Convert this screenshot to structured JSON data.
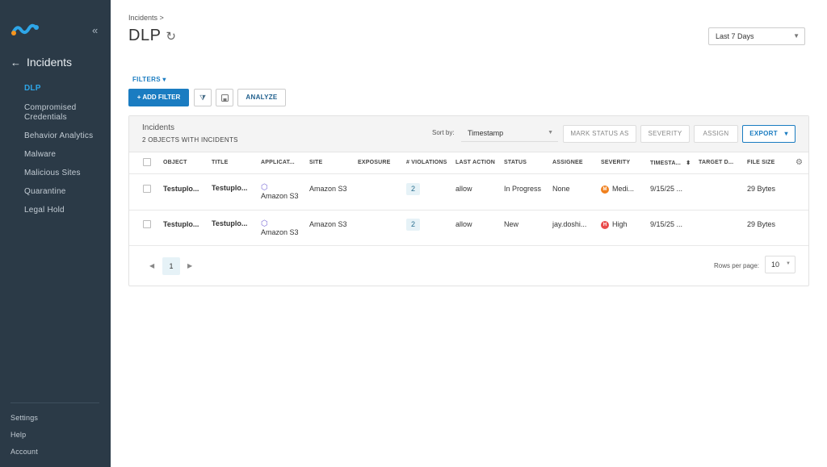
{
  "sidebar": {
    "back_label": "Incidents",
    "items": [
      {
        "label": "DLP"
      },
      {
        "label": "Compromised Credentials"
      },
      {
        "label": "Behavior Analytics"
      },
      {
        "label": "Malware"
      },
      {
        "label": "Malicious Sites"
      },
      {
        "label": "Quarantine"
      },
      {
        "label": "Legal Hold"
      }
    ],
    "bottom": [
      "Settings",
      "Help",
      "Account"
    ]
  },
  "header": {
    "breadcrumb": "Incidents >",
    "title": "DLP",
    "date_range": "Last 7 Days"
  },
  "toolbar": {
    "filters_label": "FILTERS",
    "add_filter_label": "+ ADD FILTER",
    "analyze_label": "ANALYZE"
  },
  "panel": {
    "title": "Incidents",
    "subtitle": "2 OBJECTS WITH INCIDENTS",
    "sort_label": "Sort by:",
    "sort_value": "Timestamp",
    "mark_status_label": "MARK STATUS AS",
    "severity_label": "SEVERITY",
    "assign_label": "ASSIGN",
    "export_label": "EXPORT"
  },
  "table": {
    "columns": [
      "OBJECT",
      "TITLE",
      "APPLICAT...",
      "SITE",
      "EXPOSURE",
      "# VIOLATIONS",
      "LAST ACTION",
      "STATUS",
      "ASSIGNEE",
      "SEVERITY",
      "TIMESTA...",
      "TARGET D...",
      "FILE SIZE"
    ],
    "rows": [
      {
        "object": "Testuplo...",
        "title": "Testuplo...",
        "application": "Amazon S3",
        "site": "Amazon S3",
        "exposure": "",
        "violations": "2",
        "last_action": "allow",
        "status": "In Progress",
        "assignee": "None",
        "severity": "Medi...",
        "severity_letter": "M",
        "severity_color": "#f0801e",
        "timestamp": "9/15/25 ...",
        "target": "",
        "file_size": "29 Bytes"
      },
      {
        "object": "Testuplo...",
        "title": "Testuplo...",
        "application": "Amazon S3",
        "site": "Amazon S3",
        "exposure": "",
        "violations": "2",
        "last_action": "allow",
        "status": "New",
        "assignee": "jay.doshi...",
        "severity": "High",
        "severity_letter": "H",
        "severity_color": "#e94a4a",
        "timestamp": "9/15/25 ...",
        "target": "",
        "file_size": "29 Bytes"
      }
    ]
  },
  "pagination": {
    "current_page": "1",
    "rows_label": "Rows per page:",
    "rows_value": "10"
  },
  "colors": {
    "accent": "#1a7cc1",
    "sidebar_bg": "#2b3a47",
    "active_nav": "#2ea6e8"
  }
}
